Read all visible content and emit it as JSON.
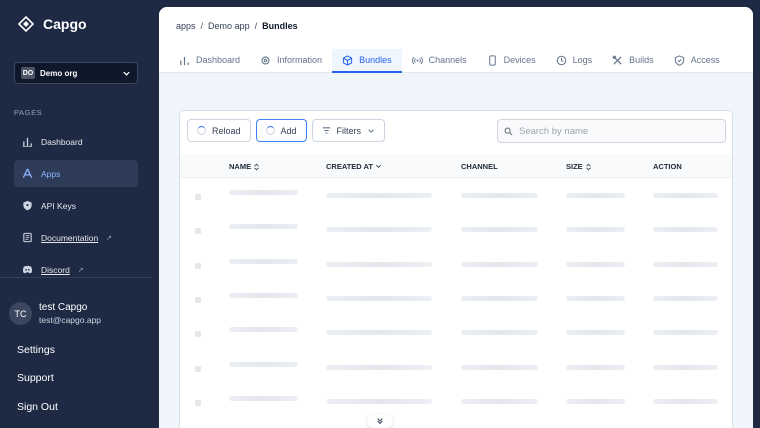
{
  "app": {
    "name": "Capgo"
  },
  "org": {
    "initials": "DO",
    "name": "Demo org"
  },
  "sidebar": {
    "section_label": "PAGES",
    "items": [
      {
        "label": "Dashboard",
        "icon": "chart-bar-icon",
        "active": false
      },
      {
        "label": "Apps",
        "icon": "apps-icon",
        "active": true
      },
      {
        "label": "API Keys",
        "icon": "shield-key-icon",
        "active": false
      },
      {
        "label": "Documentation",
        "icon": "book-icon",
        "external": true
      },
      {
        "label": "Discord",
        "icon": "discord-icon",
        "external": true
      }
    ],
    "external_glyph": "↗"
  },
  "user": {
    "initials": "TC",
    "name": "test Capgo",
    "email": "test@capgo.app"
  },
  "bottom_links": {
    "settings": "Settings",
    "support": "Support",
    "sign_out": "Sign Out"
  },
  "breadcrumb": {
    "items": [
      "apps",
      "Demo app",
      "Bundles"
    ],
    "separator": "/"
  },
  "tabs": [
    {
      "label": "Dashboard",
      "icon": "chart-bar-icon"
    },
    {
      "label": "Information",
      "icon": "gear-icon"
    },
    {
      "label": "Bundles",
      "icon": "cube-icon",
      "active": true
    },
    {
      "label": "Channels",
      "icon": "broadcast-icon"
    },
    {
      "label": "Devices",
      "icon": "phone-icon"
    },
    {
      "label": "Logs",
      "icon": "clock-icon"
    },
    {
      "label": "Builds",
      "icon": "tools-icon"
    },
    {
      "label": "Access",
      "icon": "shield-check-icon"
    }
  ],
  "toolbar": {
    "reload_label": "Reload",
    "add_label": "Add",
    "filters_label": "Filters"
  },
  "search": {
    "placeholder": "Search by name",
    "value": ""
  },
  "table": {
    "columns": [
      {
        "label": "NAME",
        "sortable": true
      },
      {
        "label": "CREATED AT",
        "sortable": true
      },
      {
        "label": "CHANNEL",
        "sortable": false
      },
      {
        "label": "SIZE",
        "sortable": true
      },
      {
        "label": "ACTION",
        "sortable": false
      }
    ],
    "state": "loading",
    "skeleton_rows": 7
  },
  "colors": {
    "accent": "#2563eb",
    "sidebar_bg": "#1e2a44",
    "active_nav_bg": "#2e3c5a"
  }
}
